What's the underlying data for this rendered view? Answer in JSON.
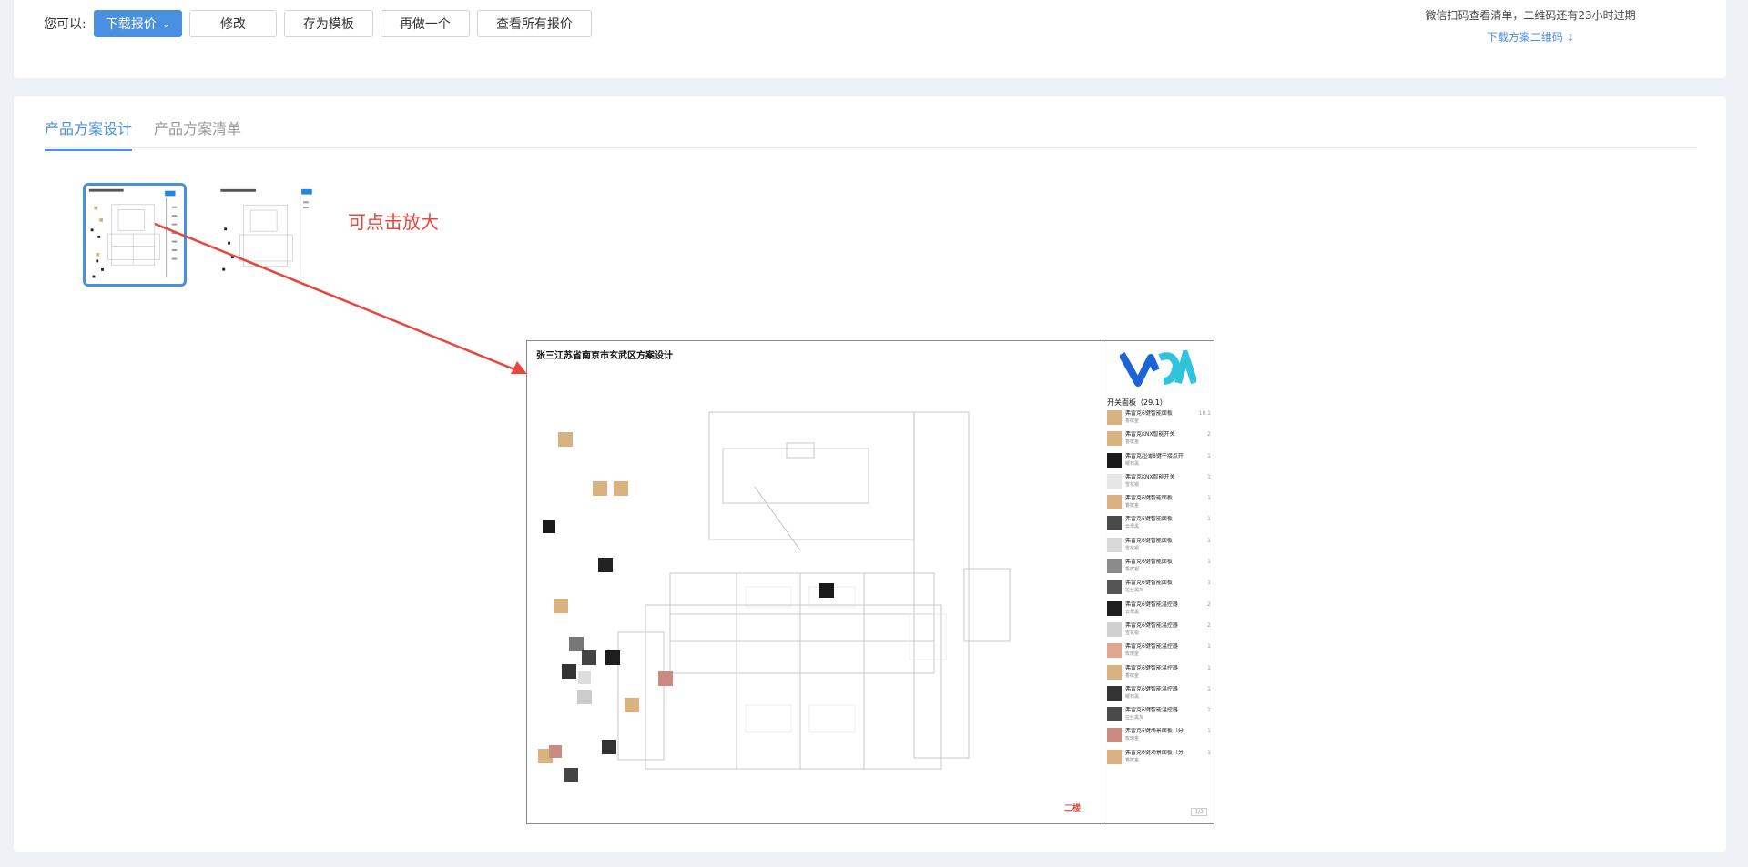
{
  "actions": {
    "prompt": "您可以:",
    "download_quote": "下载报价",
    "modify": "修改",
    "save_template": "存为模板",
    "redo": "再做一个",
    "view_all_quotes": "查看所有报价"
  },
  "qr": {
    "note": "微信扫码查看清单，二维码还有23小时过期",
    "download": "下载方案二维码"
  },
  "tabs": [
    "产品方案设计",
    "产品方案清单"
  ],
  "hint": "可点击放大",
  "preview": {
    "title": "张三江苏省南京市玄武区方案设计",
    "floor": "二楼",
    "page": "1/2",
    "sidebar_heading": "开关面板（29.1）",
    "items": [
      {
        "name": "弗雷克6键智能面板",
        "sub": "香槟金",
        "qty": "10.1",
        "color": "#d9b27f"
      },
      {
        "name": "弗雷克KNX智能开关",
        "sub": "香槟金",
        "qty": "2",
        "color": "#d9b27f"
      },
      {
        "name": "弗雷克超薄8键干接点开",
        "sub": "曜石黑",
        "qty": "1",
        "color": "#1a1a1a"
      },
      {
        "name": "弗雷克KNX智能开关",
        "sub": "雪花银",
        "qty": "1",
        "color": "#e6e6e6"
      },
      {
        "name": "弗雷克6键智能面板",
        "sub": "香槟金",
        "qty": "1",
        "color": "#d9b27f"
      },
      {
        "name": "弗雷克6键智能面板",
        "sub": "云母黑",
        "qty": "1",
        "color": "#4a4a4a"
      },
      {
        "name": "弗雷克6键智能面板",
        "sub": "雪花银",
        "qty": "1",
        "color": "#d8d8d8"
      },
      {
        "name": "弗雷克6键智能面板",
        "sub": "香槟银",
        "qty": "1",
        "color": "#8a8a8a"
      },
      {
        "name": "弗雷克6键智能面板",
        "sub": "拉丝黑灰",
        "qty": "1",
        "color": "#555555"
      },
      {
        "name": "弗雷克6键智能温控器",
        "sub": "云母黑",
        "qty": "2",
        "color": "#1e1e1e"
      },
      {
        "name": "弗雷克6键智能温控器",
        "sub": "雪花银",
        "qty": "2",
        "color": "#cfcfcf"
      },
      {
        "name": "弗雷克6键智能温控器",
        "sub": "玫瑰金",
        "qty": "1",
        "color": "#e0a88e"
      },
      {
        "name": "弗雷克6键智能温控器",
        "sub": "香槟金",
        "qty": "1",
        "color": "#d9b27f"
      },
      {
        "name": "弗雷克6键智能温控器",
        "sub": "曜石黑",
        "qty": "1",
        "color": "#333333"
      },
      {
        "name": "弗雷克6键智能温控器",
        "sub": "拉丝黑灰",
        "qty": "1",
        "color": "#4a4a4a"
      },
      {
        "name": "弗雷克6键场景面板（分",
        "sub": "玫瑰金",
        "qty": "1",
        "color": "#c98a80"
      },
      {
        "name": "弗雷克6键场景面板（分",
        "sub": "香槟金",
        "qty": "1",
        "color": "#d9b27f"
      }
    ]
  }
}
